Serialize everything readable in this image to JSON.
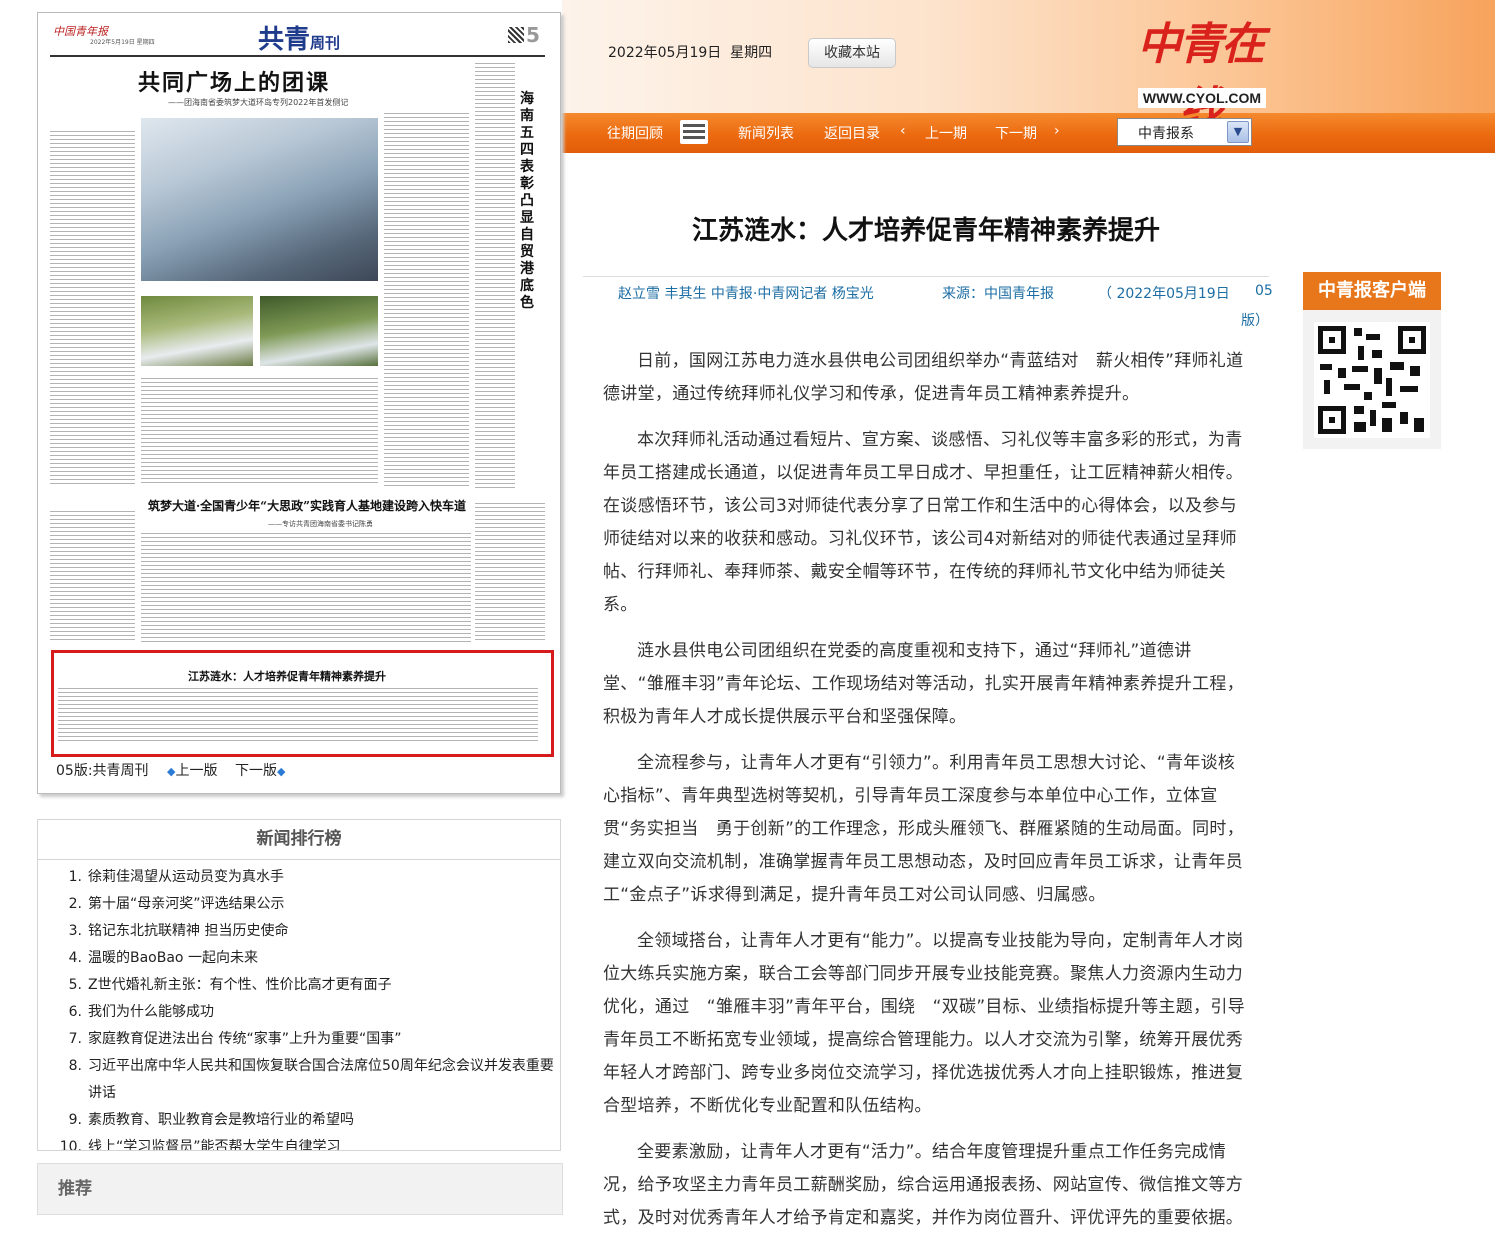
{
  "header": {
    "date": "2022年05月19日",
    "weekday": "星期四",
    "favorite_button": "收藏本站",
    "logo_text": "中青在线",
    "logo_url": "WWW.CYOL.COM",
    "nav": {
      "archive": "往期回顾",
      "news_list": "新闻列表",
      "back_to_index": "返回目录",
      "prev_issue": "上一期",
      "next_issue": "下一期"
    },
    "paper_select": {
      "selected": "中青报系"
    },
    "accent_color": "#ec6a10"
  },
  "page_preview": {
    "masthead_left": "中国青年报",
    "masthead_date": "2022年5月19日 星期四",
    "masthead": "共青",
    "masthead_sub": "周刊",
    "page_number": "5",
    "headline": "共同广场上的团课",
    "subheadline": "——团海南省委筑梦大道环岛专列2022年首发侧记",
    "side_headline": "海南五四表彰凸显自贸港底色",
    "mid_headline": "筑梦大道·全国青少年“大思政”实践育人基地建设跨入快车道",
    "mid_subheadline": "——专访共青团海南省委书记陈勇",
    "bottom_headline": "江苏涟水：人才培养促青年精神素养提升",
    "footer": {
      "page_label": "05版:共青周刊",
      "prev_page": "上一版",
      "next_page": "下一版"
    }
  },
  "ranking": {
    "title": "新闻排行榜",
    "items": [
      {
        "num": "1.",
        "text": "徐莉佳渴望从运动员变为真水手"
      },
      {
        "num": "2.",
        "text": "第十届“母亲河奖”评选结果公示"
      },
      {
        "num": "3.",
        "text": "铭记东北抗联精神 担当历史使命"
      },
      {
        "num": "4.",
        "text": "温暖的BaoBao 一起向未来"
      },
      {
        "num": "5.",
        "text": "Z世代婚礼新主张：有个性、性价比高才更有面子"
      },
      {
        "num": "6.",
        "text": "我们为什么能够成功"
      },
      {
        "num": "7.",
        "text": "家庭教育促进法出台 传统“家事”上升为重要“国事”"
      },
      {
        "num": "8.",
        "text": "习近平出席中华人民共和国恢复联合国合法席位50周年纪念会议并发表重要讲话"
      },
      {
        "num": "9.",
        "text": "素质教育、职业教育会是教培行业的希望吗"
      },
      {
        "num": "10.",
        "text": "线上“学习监督员”能否帮大学生自律学习"
      }
    ]
  },
  "recommend": {
    "title": "推荐"
  },
  "article": {
    "title": "江苏涟水：人才培养促青年精神素养提升",
    "authors": "赵立雪  丰其生  中青报·中青网记者  杨宝光",
    "source": "来源：中国青年报",
    "date": "（ 2022年05月19日",
    "page": "05",
    "page_suffix": "版）",
    "paragraphs": [
      "日前，国网江苏电力涟水县供电公司团组织举办“青蓝结对　薪火相传”拜师礼道德讲堂，通过传统拜师礼仪学习和传承，促进青年员工精神素养提升。",
      "本次拜师礼活动通过看短片、宣方案、谈感悟、习礼仪等丰富多彩的形式，为青年员工搭建成长通道，以促进青年员工早日成才、早担重任，让工匠精神薪火相传。在谈感悟环节，该公司3对师徒代表分享了日常工作和生活中的心得体会，以及参与师徒结对以来的收获和感动。习礼仪环节，该公司4对新结对的师徒代表通过呈拜师帖、行拜师礼、奉拜师茶、戴安全帽等环节，在传统的拜师礼节文化中结为师徒关系。",
      "涟水县供电公司团组织在党委的高度重视和支持下，通过“拜师礼”道德讲堂、“雏雁丰羽”青年论坛、工作现场结对等活动，扎实开展青年精神素养提升工程，积极为青年人才成长提供展示平台和坚强保障。",
      "全流程参与，让青年人才更有“引领力”。利用青年员工思想大讨论、“青年谈核心指标”、青年典型选树等契机，引导青年员工深度参与本单位中心工作，立体宣贯“务实担当　勇于创新”的工作理念，形成头雁领飞、群雁紧随的生动局面。同时，建立双向交流机制，准确掌握青年员工思想动态，及时回应青年员工诉求，让青年员工“金点子”诉求得到满足，提升青年员工对公司认同感、归属感。",
      "全领域搭台，让青年人才更有“能力”。以提高专业技能为导向，定制青年人才岗位大练兵实施方案，联合工会等部门同步开展专业技能竞赛。聚焦人力资源内生动力优化，通过　“雏雁丰羽”青年平台，围绕　“双碳”目标、业绩指标提升等主题，引导青年员工不断拓宽专业领域，提高综合管理能力。以人才交流为引擎，统筹开展优秀年轻人才跨部门、跨专业多岗位交流学习，择优选拔优秀人才向上挂职锻炼，推进复合型培养，不断优化专业配置和队伍结构。",
      "全要素激励，让青年人才更有“活力”。结合年度管理提升重点工作任务完成情况，给予攻坚主力青年员工薪酬奖励，综合运用通报表扬、网站宣传、微信推文等方式，及时对优秀青年人才给予肯定和嘉奖，并作为岗位晋升、评优评先的重要依据。"
    ]
  },
  "app_box": {
    "title": "中青报客户端",
    "qr_icon": "qr-code-icon"
  }
}
